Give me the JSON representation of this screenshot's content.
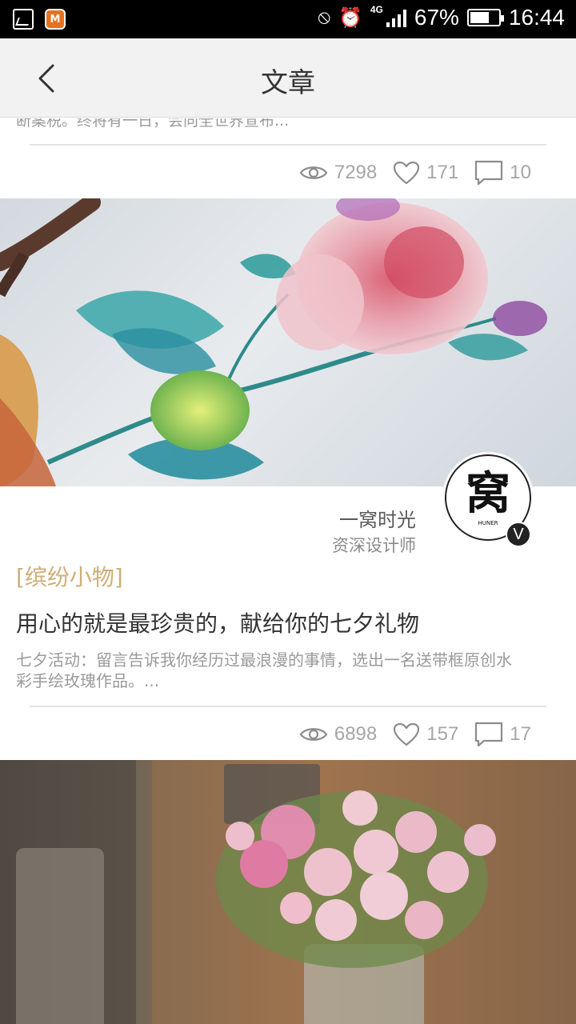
{
  "status_bar": {
    "app_badge": "M",
    "network": "4G",
    "battery_percent": "67%",
    "battery_level": 0.67,
    "time": "16:44"
  },
  "header": {
    "title": "文章",
    "back_icon": "chevron-left-icon"
  },
  "previous_article": {
    "description_tail": "断案税。终将有一日，会向全世界宣布...",
    "views": "7298",
    "likes": "171",
    "comments": "10"
  },
  "article": {
    "author_name": "一窝时光",
    "author_role": "资深设计师",
    "avatar_logo_text": "窝",
    "avatar_logo_sub": "HUNER",
    "verified_badge": "V",
    "category": "[缤纷小物]",
    "title": "用心的就是最珍贵的，献给你的七夕礼物",
    "description": "七夕活动：留言告诉我你经历过最浪漫的事情，选出一名送带框原创水彩手绘玫瑰作品。...",
    "views": "6898",
    "likes": "157",
    "comments": "17"
  },
  "icons": {
    "views": "eye-icon",
    "likes": "heart-icon",
    "comments": "comment-icon"
  },
  "colors": {
    "status_bar": "#000000",
    "header_bg": "#f2f2f2",
    "category": "#cfae78",
    "stat_text": "#a6a6a6"
  }
}
